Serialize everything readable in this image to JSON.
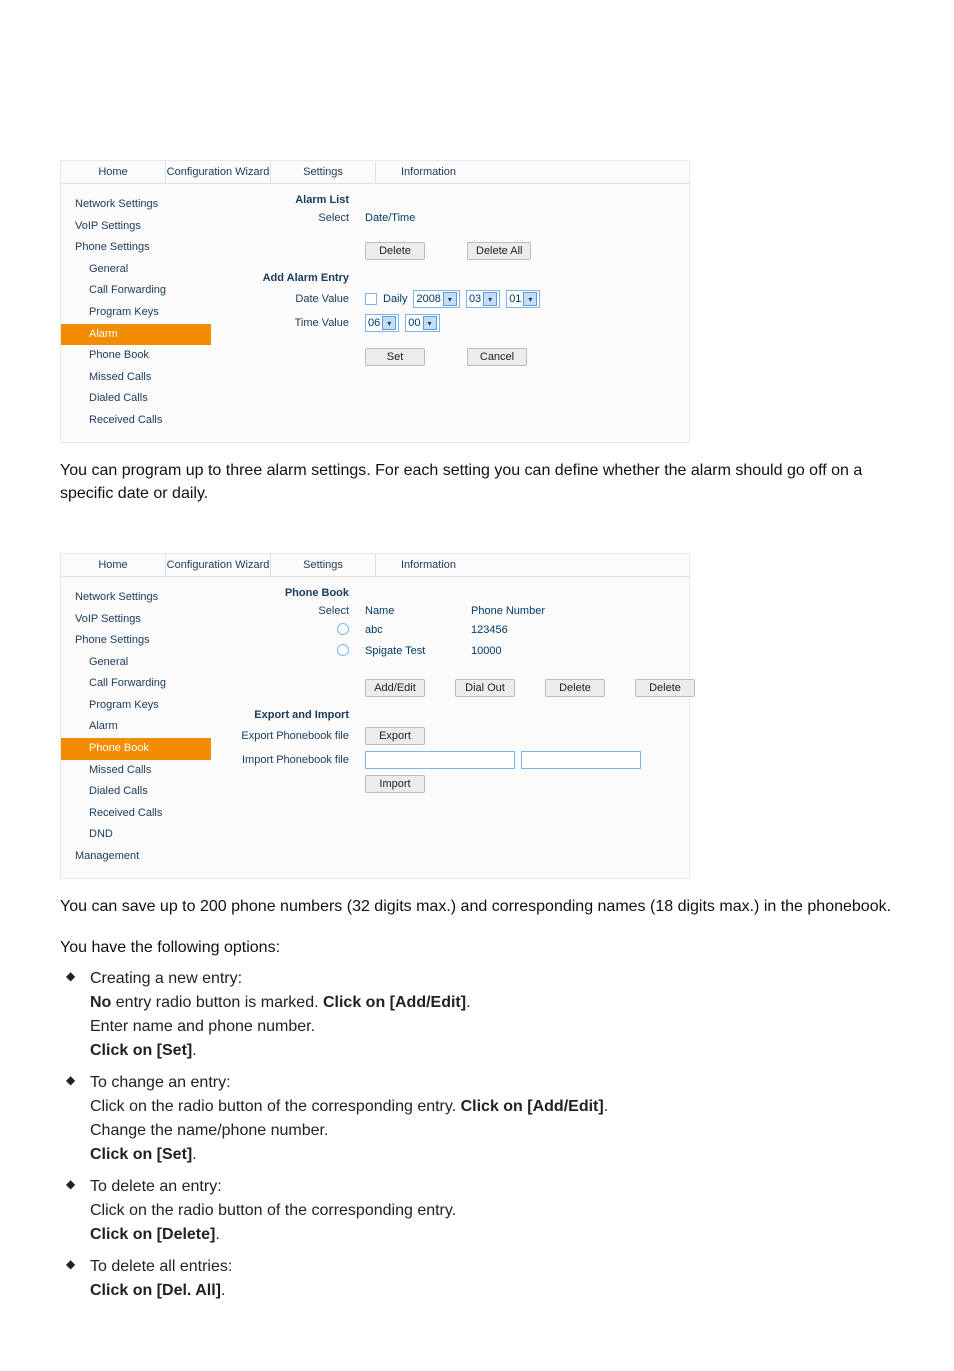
{
  "screenshot1": {
    "tabs": {
      "home": "Home",
      "wizard": "Configuration Wizard",
      "settings": "Settings",
      "info": "Information"
    },
    "sidebar": {
      "network": "Network Settings",
      "voip": "VoIP Settings",
      "phone": "Phone Settings",
      "general": "General",
      "callfwd": "Call Forwarding",
      "progkeys": "Program Keys",
      "alarm": "Alarm",
      "phonebook": "Phone Book",
      "missed": "Missed Calls",
      "dialed": "Dialed Calls",
      "received": "Received Calls"
    },
    "labels": {
      "alarm_list": "Alarm List",
      "select": "Select",
      "datetime": "Date/Time",
      "add_entry": "Add Alarm Entry",
      "date_value": "Date Value",
      "time_value": "Time Value",
      "daily": "Daily"
    },
    "buttons": {
      "delete": "Delete",
      "delete_all": "Delete All",
      "set": "Set",
      "cancel": "Cancel"
    },
    "values": {
      "year": "2008",
      "month": "03",
      "day": "01",
      "hour": "06",
      "minute": "00"
    }
  },
  "para1": "You can program up to three alarm settings. For each setting you can define whether the alarm should go off on a specific date or daily.",
  "screenshot2": {
    "tabs": {
      "home": "Home",
      "wizard": "Configuration Wizard",
      "settings": "Settings",
      "info": "Information"
    },
    "sidebar": {
      "network": "Network Settings",
      "voip": "VoIP Settings",
      "phone": "Phone Settings",
      "general": "General",
      "callfwd": "Call Forwarding",
      "progkeys": "Program Keys",
      "alarm": "Alarm",
      "phonebook": "Phone Book",
      "missed": "Missed Calls",
      "dialed": "Dialed Calls",
      "received": "Received Calls",
      "dnd": "DND",
      "management": "Management"
    },
    "labels": {
      "phone_book": "Phone Book",
      "select": "Select",
      "name": "Name",
      "phone_number": "Phone Number",
      "export_import": "Export and Import",
      "export_file": "Export Phonebook file",
      "import_file": "Import Phonebook file"
    },
    "rows": [
      {
        "name": "abc",
        "number": "123456"
      },
      {
        "name": "Spigate Test",
        "number": "10000"
      }
    ],
    "buttons": {
      "add_edit": "Add/Edit",
      "dial_out": "Dial Out",
      "delete": "Delete",
      "delete2": "Delete",
      "export": "Export",
      "import": "Import"
    }
  },
  "para2": "You can save up to 200 phone numbers (32 digits max.) and corresponding names (18 digits max.) in the phonebook.",
  "para3": "You have the following options:",
  "options": {
    "o1_title": "Creating a new entry:",
    "o1_l1a": "No",
    "o1_l1b": " entry radio button is marked. ",
    "o1_l1c": "Click on [Add/Edit]",
    "o1_l1d": ".",
    "o1_l2": "Enter name and phone number.",
    "o1_l3": "Click on [Set]",
    "o1_l3b": ".",
    "o2_title": "To change an entry:",
    "o2_l1a": "Click on the radio button of the corresponding entry. ",
    "o2_l1b": "Click on [Add/Edit]",
    "o2_l1c": ".",
    "o2_l2": "Change the name/phone number.",
    "o2_l3": "Click on [Set]",
    "o2_l3b": ".",
    "o3_title": "To delete an entry:",
    "o3_l1": "Click on the radio button of the corresponding entry.",
    "o3_l2": "Click on [Delete]",
    "o3_l2b": ".",
    "o4_title": "To delete all entries:",
    "o4_l1": "Click on [Del. All]",
    "o4_l1b": "."
  }
}
